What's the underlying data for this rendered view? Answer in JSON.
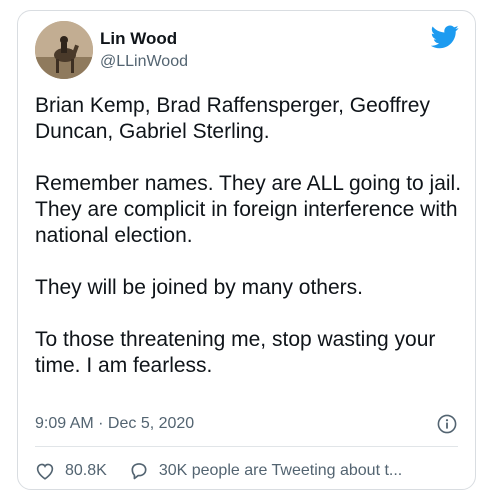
{
  "author": {
    "name": "Lin Wood",
    "handle": "@LLinWood"
  },
  "tweet": {
    "paragraphs": [
      "Brian Kemp, Brad Raffensperger, Geoffrey Duncan, Gabriel Sterling.",
      "Remember names. They are ALL going to jail. They are complicit in foreign interference with national election.",
      "They will be joined by many others.",
      "To those threatening me, stop wasting your time. I am fearless."
    ],
    "timestamp": "9:09 AM · Dec 5, 2020"
  },
  "actions": {
    "likes": "80.8K",
    "conversation": "30K people are Tweeting about t..."
  },
  "icons": {
    "logo": "twitter-bird-icon",
    "info": "info-icon",
    "like": "heart-icon",
    "reply": "speech-bubble-icon"
  },
  "colors": {
    "brand": "#1d9bf0",
    "text": "#0f1419",
    "muted": "#536471"
  }
}
